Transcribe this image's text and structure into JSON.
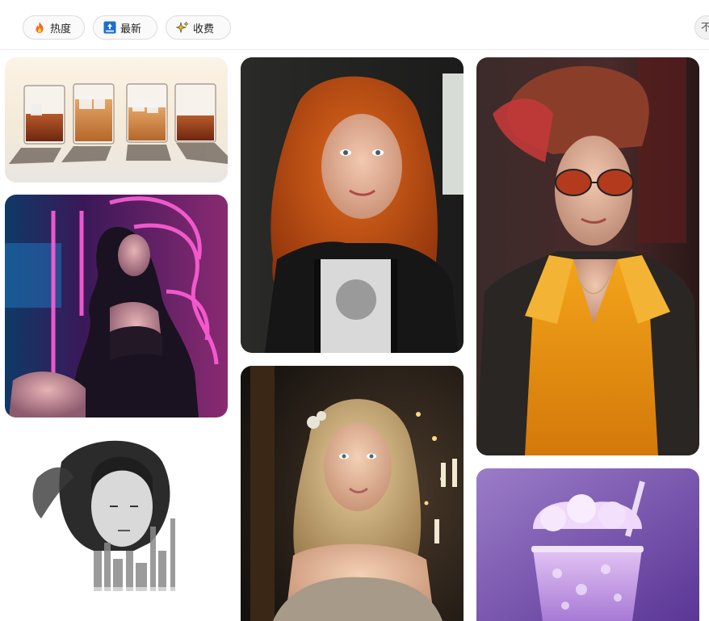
{
  "filters": {
    "hot_label": "热度",
    "new_label": "最新",
    "paid_label": "收费",
    "more_label": "不"
  },
  "icons": {
    "hot": "fire-icon",
    "new": "top-badge-icon",
    "paid": "sparkle-icon"
  },
  "colors": {
    "chip_border": "#dcdcdc",
    "chip_bg": "#fafafa",
    "fire_orange": "#f26b1d",
    "top_blue": "#1a6fd1",
    "sparkle_yellow": "#f4c20d"
  },
  "gallery": {
    "columns": [
      {
        "items": [
          {
            "subject": "whiskey-glasses"
          },
          {
            "subject": "neon-woman"
          },
          {
            "subject": "double-exposure-portrait"
          }
        ]
      },
      {
        "items": [
          {
            "subject": "red-curly-hair-woman"
          },
          {
            "subject": "blonde-woman-candles"
          }
        ]
      },
      {
        "items": [
          {
            "subject": "punk-woman-orange-shirt"
          },
          {
            "subject": "purple-slush-drink"
          }
        ]
      }
    ]
  }
}
